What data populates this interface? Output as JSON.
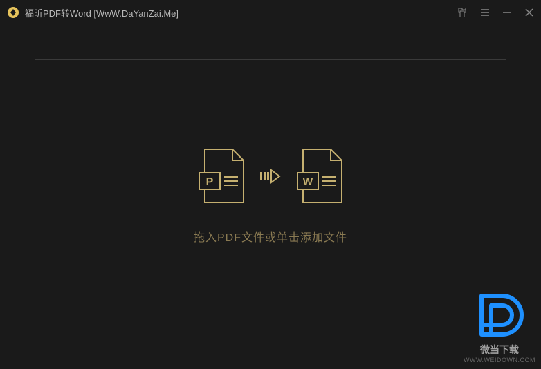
{
  "titlebar": {
    "title": "福昕PDF转Word [WwW.DaYanZai.Me]"
  },
  "main": {
    "drop_text": "拖入PDF文件或单击添加文件",
    "pdf_letter": "P",
    "word_letter": "W"
  },
  "watermark": {
    "text": "微当下载",
    "url": "WWW.WEIDOWN.COM"
  },
  "colors": {
    "accent": "#c5b070",
    "background": "#1a1a1a",
    "border": "#3a3a3a",
    "watermark_blue": "#1e90ff"
  }
}
